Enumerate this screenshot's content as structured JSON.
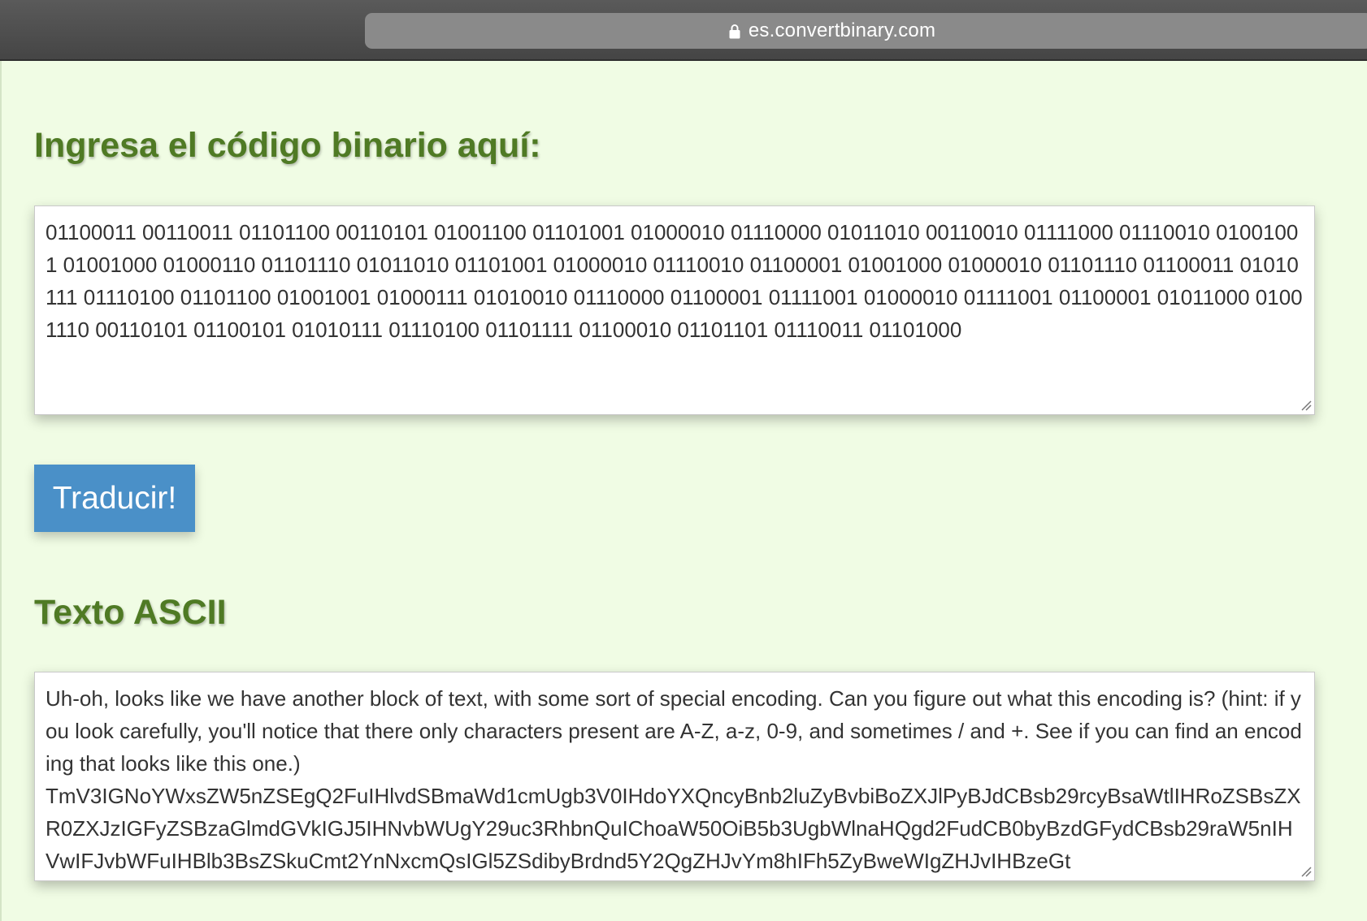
{
  "browser": {
    "url": "es.convertbinary.com",
    "secure": true
  },
  "converter": {
    "input_title": "Ingresa el código binario aquí:",
    "binary_input": "01100011 00110011 01101100 00110101 01001100 01101001 01000010 01110000 01011010 00110010 01111000 01110010 01001001 01001000 01000110 01101110 01011010 01101001 01000010 01110010 01100001 01001000 01000010 01101110 01100011 01010111 01110100 01101100 01001001 01000111 01010010 01110000 01100001 01111001 01000010 01111001 01100001 01011000 01001110 00110101 01100101 01010111 01110100 01101111 01100010 01101101 01110011 01101000",
    "translate_label": "Traducir!",
    "output_title": "Texto ASCII",
    "ascii_output": "Uh-oh, looks like we have another block of text, with some sort of special encoding. Can you figure out what this encoding is? (hint: if you look carefully, you'll notice that there only characters present are A-Z, a-z, 0-9, and sometimes / and +. See if you can find an encoding that looks like this one.)\nTmV3IGNoYWxsZW5nZSEgQ2FuIHlvdSBmaWd1cmUgb3V0IHdoYXQncyBnb2luZyBvbiBoZXJlPyBJdCBsb29rcyBsaWtlIHRoZSBsZXR0ZXJzIGFyZSBzaGlmdGVkIGJ5IHNvbWUgY29uc3RhbnQuIChoaW50OiB5b3UgbWlnaHQgd2FudCB0byBzdGFydCBsb29raW5nIHVwIFJvbWFuIHBlb3BsZSkuCmt2YnNxcmQsIGl5ZSdibyBrdnd5Y2QgZHJvYm8hIFh5ZyBweWIgZHJvIHBzeGt"
  },
  "colors": {
    "page_background": "#f0fce4",
    "heading": "#4f7a24",
    "button": "#4a90c8"
  }
}
